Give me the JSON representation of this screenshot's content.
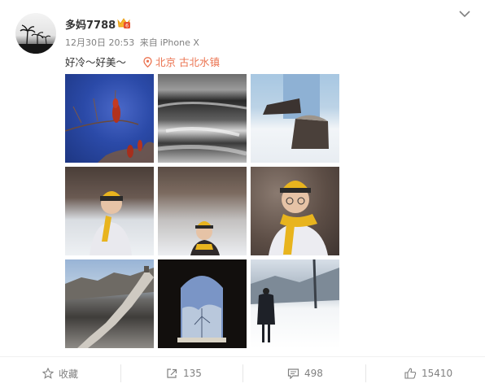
{
  "post": {
    "username": "多妈7788",
    "date": "12月30日 20:53",
    "source_prefix": "来自",
    "device": "iPhone X",
    "text": "好冷～好美～",
    "location": "北京 古北水镇"
  },
  "photos": [
    {
      "icon": "photo"
    },
    {
      "icon": "photo"
    },
    {
      "icon": "photo"
    },
    {
      "icon": "photo"
    },
    {
      "icon": "photo"
    },
    {
      "icon": "photo"
    },
    {
      "icon": "photo"
    },
    {
      "icon": "photo"
    },
    {
      "icon": "photo"
    }
  ],
  "actions": {
    "favorite_label": "收藏",
    "repost_count": "135",
    "comment_count": "498",
    "like_count": "15410"
  },
  "colors": {
    "location": "#eb7350",
    "meta": "#808080",
    "text": "#333333"
  }
}
